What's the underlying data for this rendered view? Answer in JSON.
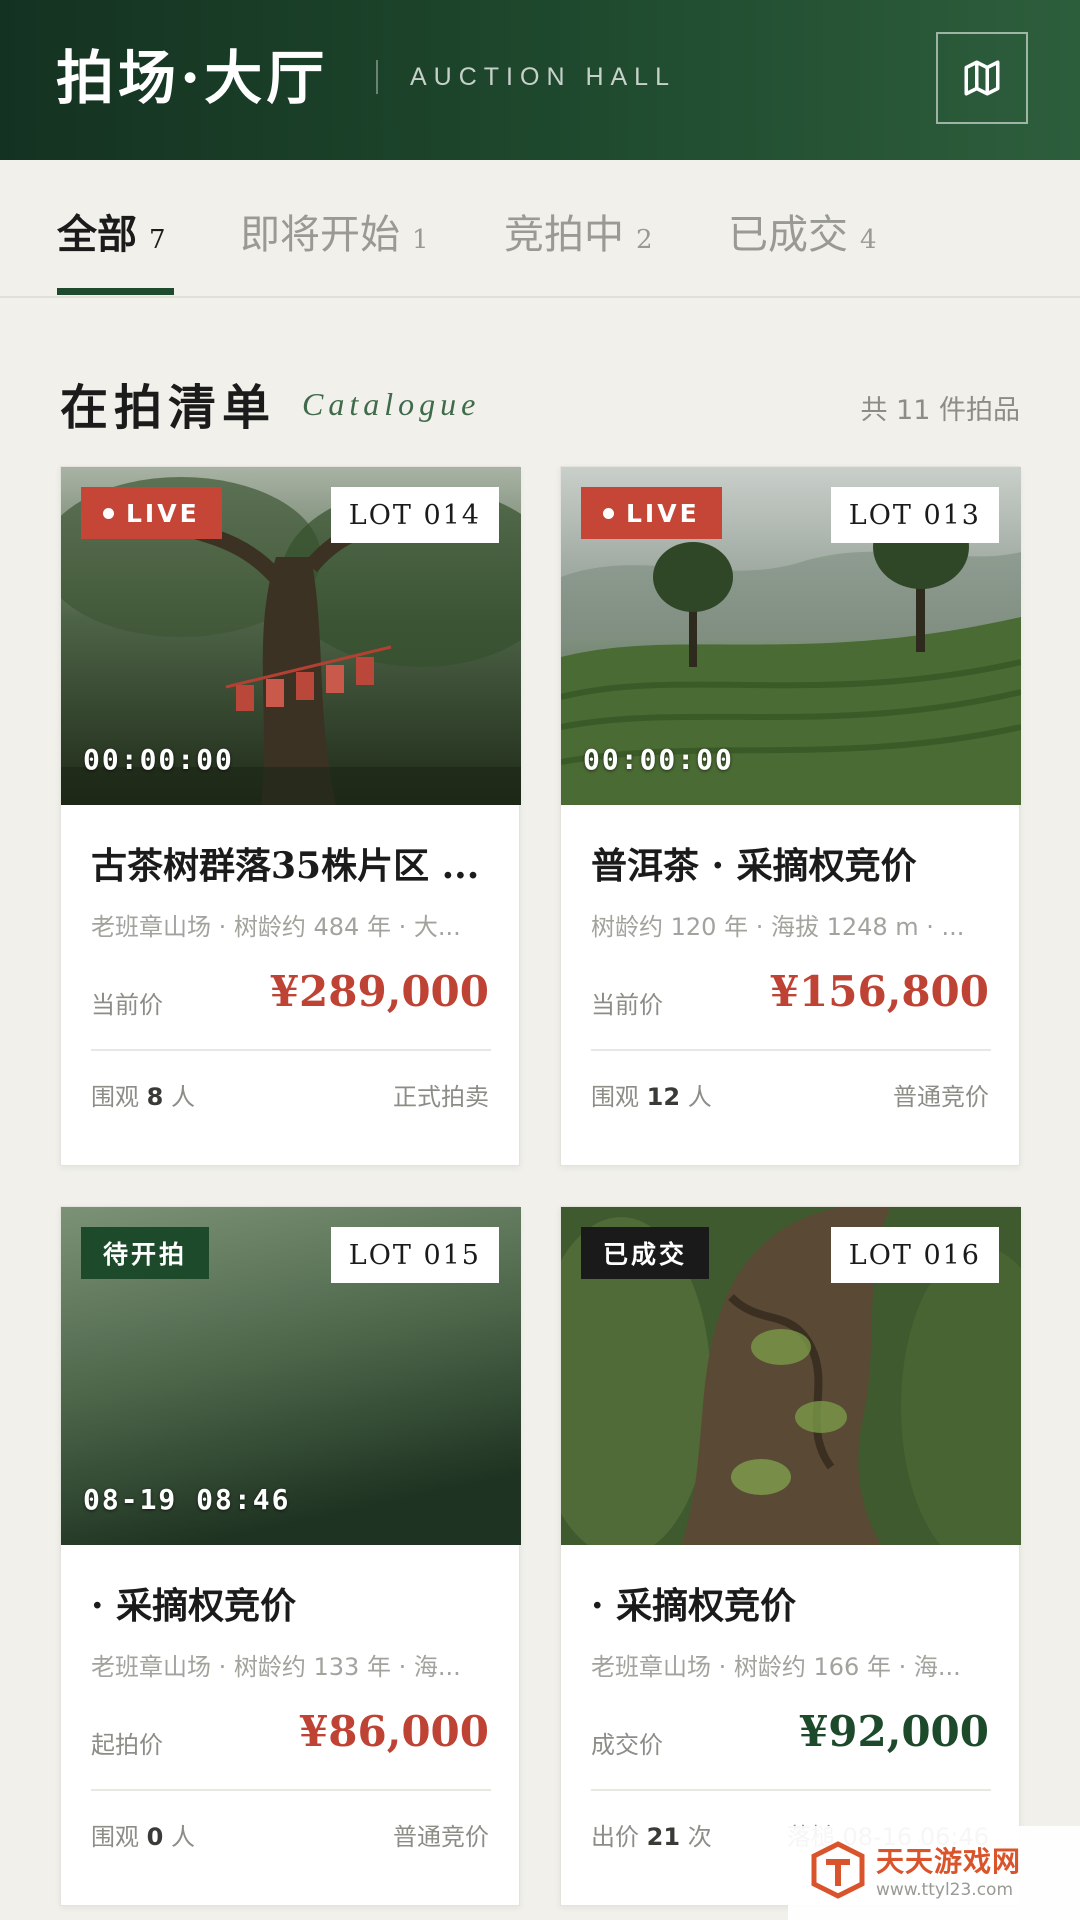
{
  "header": {
    "title": "拍场·大厅",
    "subtitle": "AUCTION HALL",
    "map_icon": "map-icon"
  },
  "tabs": [
    {
      "label": "全部",
      "count": "7",
      "active": true
    },
    {
      "label": "即将开始",
      "count": "1",
      "active": false
    },
    {
      "label": "竞拍中",
      "count": "2",
      "active": false
    },
    {
      "label": "已成交",
      "count": "4",
      "active": false
    }
  ],
  "section": {
    "title": "在拍清单",
    "subtitle": "Catalogue",
    "count_text": "共 11 件拍品"
  },
  "cards": [
    {
      "status": "LIVE",
      "lot": "LOT 014",
      "time": "00:00:00",
      "name": "古茶树群落35株片区 ...",
      "meta": "老班章山场 · 树龄约 484 年 · 大...",
      "price_label": "当前价",
      "price": "¥289,000",
      "foot_left_prefix": "围观",
      "foot_left_value": "8",
      "foot_left_suffix": "人",
      "foot_right": "正式拍卖"
    },
    {
      "status": "LIVE",
      "lot": "LOT 013",
      "time": "00:00:00",
      "name": "普洱茶 · 采摘权竞价",
      "meta": "树龄约 120 年 · 海拔 1248 m · ...",
      "price_label": "当前价",
      "price": "¥156,800",
      "foot_left_prefix": "围观",
      "foot_left_value": "12",
      "foot_left_suffix": "人",
      "foot_right": "普通竞价"
    },
    {
      "status": "待开拍",
      "lot": "LOT 015",
      "time": "08-19 08:46",
      "name": "· 采摘权竞价",
      "meta": "老班章山场 · 树龄约 133 年 · 海...",
      "price_label": "起拍价",
      "price": "¥86,000",
      "foot_left_prefix": "围观",
      "foot_left_value": "0",
      "foot_left_suffix": "人",
      "foot_right": "普通竞价"
    },
    {
      "status": "已成交",
      "lot": "LOT 016",
      "name": "· 采摘权竞价",
      "meta": "老班章山场 · 树龄约 166 年 · 海...",
      "price_label": "成交价",
      "price": "¥92,000",
      "foot_left_prefix": "出价",
      "foot_left_value": "21",
      "foot_left_suffix": "次",
      "foot_right": "落槌 08-16 06:46"
    }
  ],
  "watermark": {
    "name": "天天游戏网",
    "url": "www.ttyl23.com"
  },
  "colors": {
    "brand_green": "#1f4a2e",
    "live_red": "#c54636",
    "price_red": "#bf4334",
    "background": "#f1f0ea"
  }
}
